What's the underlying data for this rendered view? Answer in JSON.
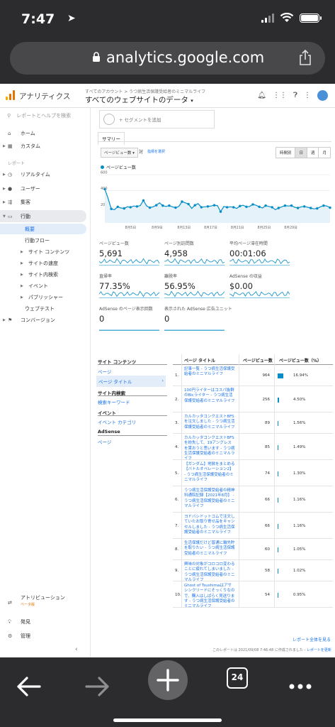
{
  "status": {
    "time": "7:47"
  },
  "browser": {
    "url": "analytics.google.com",
    "tab_count": "24"
  },
  "ga": {
    "app_name": "アナリティクス",
    "breadcrumb": "すべてのアカウント > うつ病生活保護受給者のミニマルライフ",
    "view_name": "すべてのウェブサイトのデータ"
  },
  "sidebar": {
    "search_placeholder": "レポートとヘルプを検索",
    "home": "ホーム",
    "custom": "カスタム",
    "report_label": "レポート",
    "realtime": "リアルタイム",
    "users": "ユーザー",
    "acquisition": "集客",
    "behavior": "行動",
    "overview": "概要",
    "behavior_flow": "行動フロー",
    "site_content": "サイト コンテンツ",
    "site_speed": "サイトの速度",
    "site_search": "サイト内検索",
    "events": "イベント",
    "publisher": "パブリッシャー",
    "experiments": "ウェブテスト",
    "conversions": "コンバージョン",
    "attribution": "アトリビューション",
    "attribution_badge": "ベータ版",
    "discover": "発見",
    "admin": "管理"
  },
  "segment": {
    "add_label": "+ セグメントを追加"
  },
  "tabs": {
    "summary": "サマリー"
  },
  "controls": {
    "metric": "ページビュー数 ▾",
    "vs": "対",
    "select_metric": "指標を選択",
    "time_buttons": [
      "時間別",
      "日",
      "週",
      "月"
    ]
  },
  "chart_data": {
    "type": "line",
    "series": [
      {
        "name": "ページビュー数",
        "values": [
          420,
          310,
          175,
          165,
          200,
          185,
          180,
          200,
          195,
          210,
          205,
          215,
          280,
          210,
          190,
          200,
          220,
          250,
          215,
          205,
          215,
          200,
          190,
          205,
          265,
          250,
          235,
          180,
          220,
          240,
          195,
          200,
          205,
          210,
          220,
          215,
          140,
          205,
          195,
          200,
          195,
          180,
          210,
          220,
          200,
          205,
          230,
          220,
          200,
          185,
          215,
          205,
          195,
          165,
          185,
          200,
          215,
          210,
          215,
          195,
          185,
          200,
          205,
          195,
          185,
          175,
          180,
          200,
          215,
          210,
          190
        ]
      }
    ],
    "x_labels": [
      "8月5日",
      "8月9日",
      "8月13日",
      "8月17日",
      "8月21日",
      "8月25日",
      "8月29日"
    ],
    "y_ticks": [
      200,
      400,
      600
    ],
    "ylim": [
      0,
      600
    ],
    "color": "#058dc7",
    "grid": true
  },
  "tiles": [
    {
      "label": "ページビュー数",
      "value": "5,691"
    },
    {
      "label": "ページ別訪問数",
      "value": "4,958"
    },
    {
      "label": "平均ページ滞在時間",
      "value": "00:01:06"
    },
    {
      "label": "直帰率",
      "value": "77.35%"
    },
    {
      "label": "離脱率",
      "value": "56.95%"
    },
    {
      "label": "AdSense の収益",
      "value": "$0.00"
    },
    {
      "label": "AdSense のページ表示回数",
      "value": "0"
    },
    {
      "label": "表示された AdSense 広告ユニット",
      "value": "0"
    }
  ],
  "left_sections": {
    "site_content": "サイト コンテンツ",
    "page": "ページ",
    "page_title": "ページ タイトル",
    "site_search": "サイト内検索",
    "search_keyword": "検索キーワード",
    "event": "イベント",
    "event_category": "イベント カテゴリ",
    "adsense": "AdSense",
    "adsense_page": "ページ"
  },
  "table": {
    "headers": {
      "title": "ページ タイトル",
      "views": "ページビュー数",
      "pct": "ページビュー数（%）"
    },
    "rows": [
      {
        "n": "1.",
        "title": "記事一覧 - うつ病生活保護受給者のミニマルライフ",
        "views": "964",
        "pct": "16.94%",
        "share": 16.94
      },
      {
        "n": "2.",
        "title": "100円ライターはコスパ抜群のBicライター - うつ病生活保護受給者のミニマルライフ",
        "views": "256",
        "pct": "4.50%",
        "share": 4.5
      },
      {
        "n": "3.",
        "title": "カルカッタコンクエストBFSを注文しました - うつ病生活保護受給者のミニマルライフ",
        "views": "89",
        "pct": "1.56%",
        "share": 1.56
      },
      {
        "n": "4.",
        "title": "カルカッタコンクエストBFSを紛失して、19アングレスを貰おうと思います - うつ病生活保護受給者のミニマルライフ",
        "views": "85",
        "pct": "1.49%",
        "share": 1.49
      },
      {
        "n": "5.",
        "title": "【ガンダム】地獄をまとめる【バトルオペレーション2】 - うつ病生活保護受給者のミニマルライフ",
        "views": "74",
        "pct": "1.30%",
        "share": 1.3
      },
      {
        "n": "6.",
        "title": "うつ病生活保護受給者の精神科通院記録【2021年8月】 - うつ病生活保護受給者のミニマルライフ",
        "views": "66",
        "pct": "1.16%",
        "share": 1.16
      },
      {
        "n": "7.",
        "title": "ヨドバシドットコムで注文していたお取り寄せ品をキャンセルしました - うつ病生活保護受給者のミニマルライフ",
        "views": "66",
        "pct": "1.16%",
        "share": 1.16
      },
      {
        "n": "8.",
        "title": "生活保護だけど普通に輪先貯を取りたい - うつ病生活保護受給者のミニマルライフ",
        "views": "60",
        "pct": "1.05%",
        "share": 1.05
      },
      {
        "n": "9.",
        "title": "興味の対象がコロコロ変わることに疲れてしまいました - うつ病生活保護受給者のミニマルライフ",
        "views": "58",
        "pct": "1.02%",
        "share": 1.02
      },
      {
        "n": "10.",
        "title": "Ghost of Tsushimaはアサシンクリードにそっくりなので、購入はしばらく見送ります - うつ病生活保護受給者のミニマルライフ",
        "views": "54",
        "pct": "0.95%",
        "share": 0.95
      }
    ]
  },
  "footer": {
    "full_report": "レポート全体を見る",
    "note": "このレポートは 2021/09/08 7:46:48 に作成されました -",
    "refresh": "レポートを更新"
  }
}
